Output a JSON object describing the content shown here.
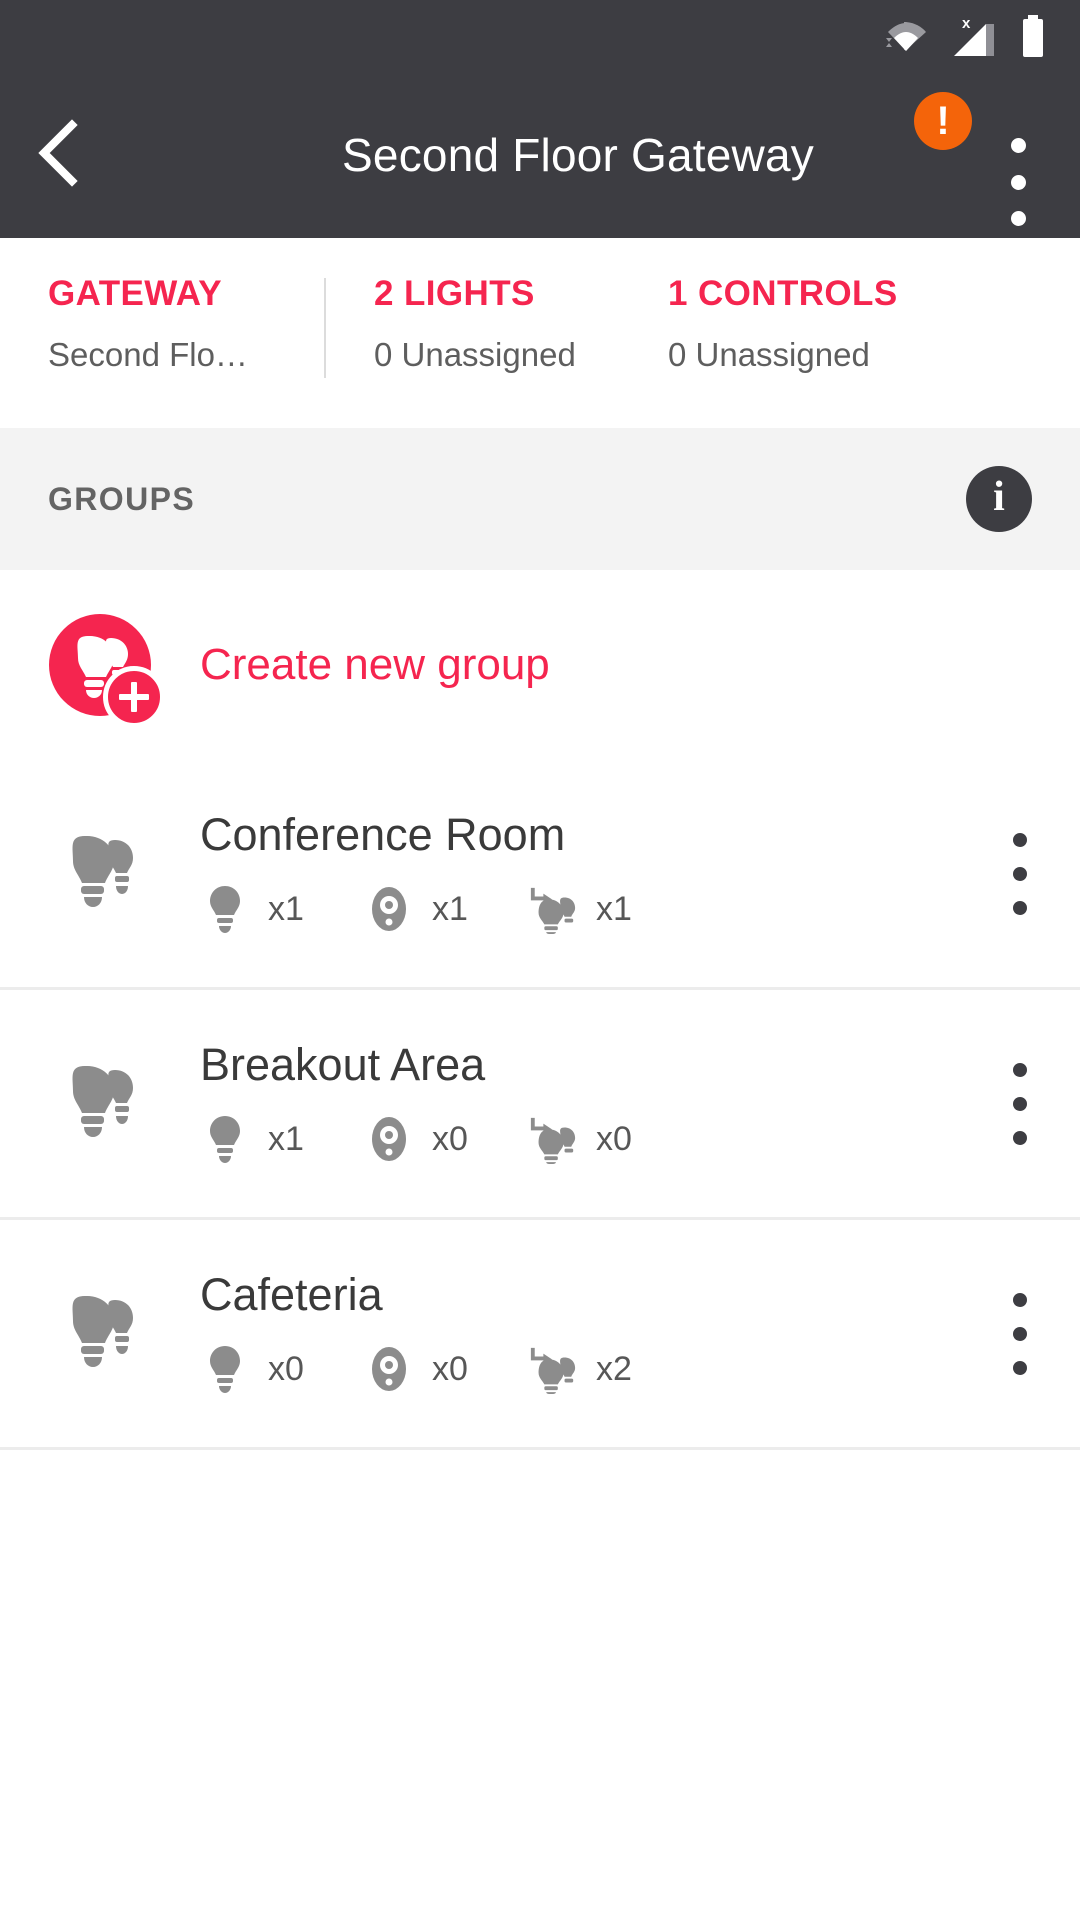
{
  "statusbar": {
    "icons": [
      {
        "name": "wifi-icon",
        "label": "wifi-connected"
      },
      {
        "name": "cellular-no-sim-icon",
        "label": "X"
      },
      {
        "name": "battery-icon",
        "label": "battery-full"
      }
    ]
  },
  "appbar": {
    "back_icon": "chevron-left-icon",
    "title": "Second Floor Gateway",
    "warning_icon": "alert-exclamation-icon",
    "warning_glyph": "!",
    "overflow_icon": "more-vert-icon"
  },
  "stats": [
    {
      "title": "GATEWAY",
      "subtitle": "Second Flo…",
      "divider_before": false
    },
    {
      "title": "2 LIGHTS",
      "subtitle": "0 Unassigned",
      "divider_before": true
    },
    {
      "title": "1 CONTROLS",
      "subtitle": "0 Unassigned",
      "divider_before": false
    }
  ],
  "section": {
    "label": "GROUPS",
    "info_icon": "info-circle-icon",
    "info_glyph": "i"
  },
  "create_group": {
    "icon": "two-bulbs-add-icon",
    "label": "Create new group"
  },
  "groups": [
    {
      "icon": "two-bulbs-icon",
      "name": "Conference Room",
      "metrics": [
        {
          "icon": "bulb-icon",
          "count": "x1"
        },
        {
          "icon": "rotary-control-icon",
          "count": "x1"
        },
        {
          "icon": "scene-bulb-icon",
          "count": "x1"
        }
      ],
      "overflow_icon": "more-vert-icon"
    },
    {
      "icon": "two-bulbs-icon",
      "name": "Breakout Area",
      "metrics": [
        {
          "icon": "bulb-icon",
          "count": "x1"
        },
        {
          "icon": "rotary-control-icon",
          "count": "x0"
        },
        {
          "icon": "scene-bulb-icon",
          "count": "x0"
        }
      ],
      "overflow_icon": "more-vert-icon"
    },
    {
      "icon": "two-bulbs-icon",
      "name": "Cafeteria",
      "metrics": [
        {
          "icon": "bulb-icon",
          "count": "x0"
        },
        {
          "icon": "rotary-control-icon",
          "count": "x0"
        },
        {
          "icon": "scene-bulb-icon",
          "count": "x2"
        }
      ],
      "overflow_icon": "more-vert-icon"
    }
  ],
  "colors": {
    "accent": "#f5254f",
    "header_bg": "#3d3d42",
    "warning": "#f4640a",
    "section_bg": "#f3f3f3",
    "icon_gray": "#8c8c8c",
    "divider": "#ececec"
  }
}
